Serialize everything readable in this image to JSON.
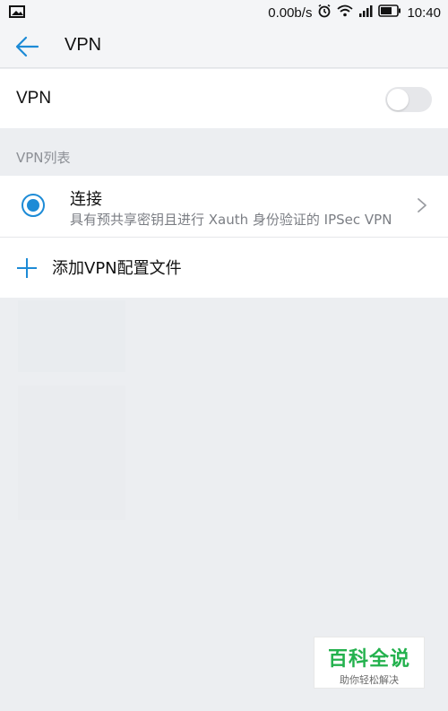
{
  "status_bar": {
    "net_speed": "0.00b/s",
    "time": "10:40",
    "icons": [
      "image-icon",
      "alarm-icon",
      "wifi-icon",
      "signal-icon",
      "battery-icon"
    ]
  },
  "app_bar": {
    "title": "VPN",
    "back_icon": "arrow-left-icon"
  },
  "vpn_toggle": {
    "label": "VPN",
    "enabled": false
  },
  "vpn_list": {
    "header": "VPN列表",
    "items": [
      {
        "title": "连接",
        "subtitle": "具有预共享密钥且进行 Xauth 身份验证的 IPSec VPN",
        "selected": true
      }
    ],
    "add_label": "添加VPN配置文件"
  },
  "watermark": {
    "main": "百科全说",
    "sub": "助你轻松解决"
  },
  "colors": {
    "accent": "#1d8bd6",
    "background": "#eceef1",
    "watermark_green": "#23b14d"
  }
}
